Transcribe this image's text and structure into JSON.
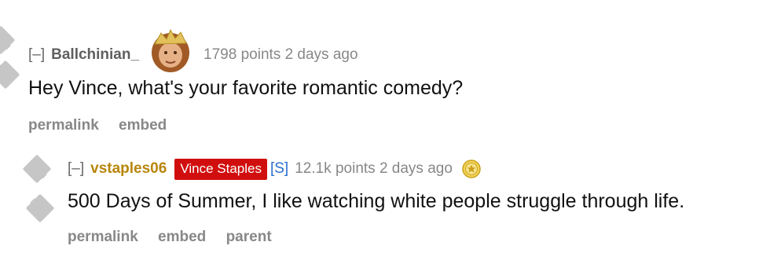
{
  "comment1": {
    "collapse": "[–]",
    "author": "Ballchinian_",
    "score": "1798 points 2 days ago",
    "body": "Hey Vince, what's your favorite romantic comedy?",
    "buttons": [
      "permalink",
      "embed"
    ]
  },
  "comment2": {
    "collapse": "[–]",
    "author": "vstaples06",
    "flair": "Vince Staples",
    "submitter_tag": "[S]",
    "score": "12.1k points 2 days ago",
    "body": "500 Days of Summer, I like watching white people struggle through life.",
    "buttons": [
      "permalink",
      "embed",
      "parent"
    ]
  },
  "icons": {
    "avatar": "avatar-photo",
    "gilded": "gold-award-star-icon",
    "vote": "vote-arrow-icon"
  },
  "colors": {
    "flair_bg": "#d10e0e",
    "op_author": "#b8860b",
    "submitter": "#2a6fcf",
    "meta": "#888888",
    "vote_arrow": "#c6c6c6",
    "gilded": "#c9a11a"
  }
}
